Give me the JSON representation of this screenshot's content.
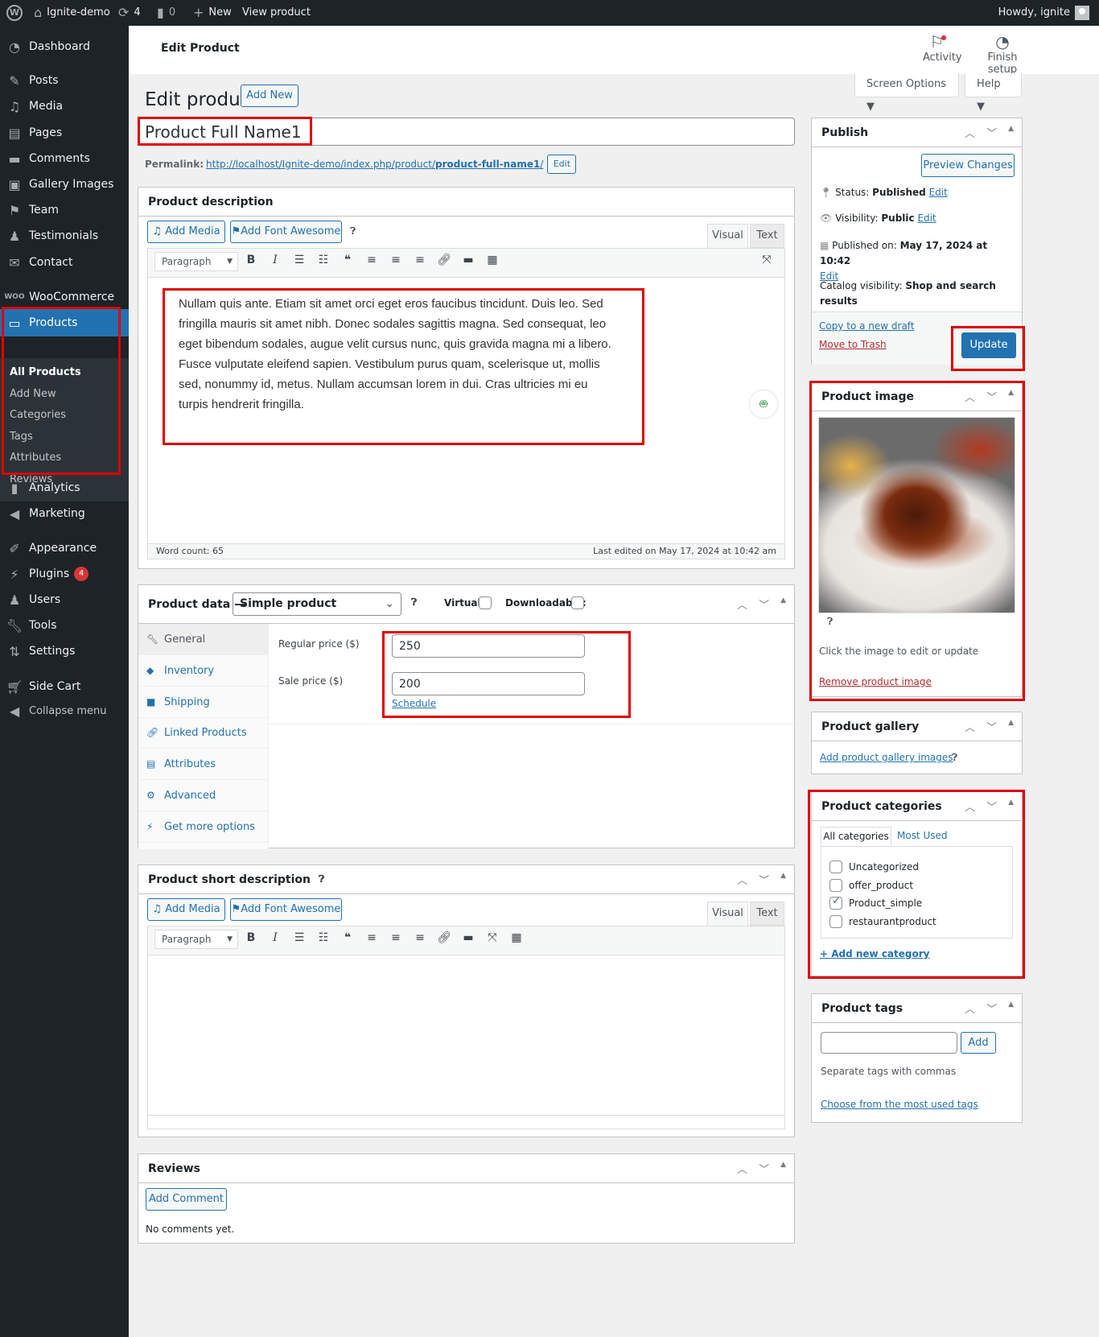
{
  "admin_bar": {
    "site_name": "Ignite-demo",
    "updates_count": "4",
    "comments_count": "0",
    "new_label": "New",
    "view_label": "View product",
    "greeting": "Howdy, ignite"
  },
  "sidebar": {
    "items": [
      {
        "label": "Dashboard",
        "icon": "dashboard-icon"
      },
      {
        "label": "Posts",
        "icon": "pin-icon"
      },
      {
        "label": "Media",
        "icon": "media-icon"
      },
      {
        "label": "Pages",
        "icon": "pages-icon"
      },
      {
        "label": "Comments",
        "icon": "comment-icon"
      },
      {
        "label": "Gallery Images",
        "icon": "gallery-icon"
      },
      {
        "label": "Team",
        "icon": "team-icon"
      },
      {
        "label": "Testimonials",
        "icon": "person-icon"
      },
      {
        "label": "Contact",
        "icon": "mail-icon"
      },
      {
        "label": "WooCommerce",
        "icon": "woo-icon"
      },
      {
        "label": "Products",
        "icon": "archive-icon"
      },
      {
        "label": "Analytics",
        "icon": "chart-icon"
      },
      {
        "label": "Marketing",
        "icon": "megaphone-icon"
      },
      {
        "label": "Appearance",
        "icon": "brush-icon"
      },
      {
        "label": "Plugins",
        "icon": "plugin-icon",
        "badge": "4"
      },
      {
        "label": "Users",
        "icon": "users-icon"
      },
      {
        "label": "Tools",
        "icon": "wrench-icon"
      },
      {
        "label": "Settings",
        "icon": "settings-icon"
      },
      {
        "label": "Side Cart",
        "icon": "cart-icon"
      },
      {
        "label": "Collapse menu",
        "icon": "collapse-icon"
      }
    ],
    "products_submenu": [
      "All Products",
      "Add New",
      "Categories",
      "Tags",
      "Attributes",
      "Reviews"
    ]
  },
  "header": {
    "title": "Edit Product",
    "activity_label": "Activity",
    "finish_setup_label": "Finish setup",
    "screen_options_label": "Screen Options ▼",
    "help_label": "Help ▼"
  },
  "page": {
    "heading": "Edit product",
    "add_new_label": "Add New",
    "product_title": "Product Full Name1",
    "permalink_label": "Permalink:",
    "permalink_base": "http://localhost/Ignite-demo/index.php/product/",
    "permalink_slug": "product-full-name1",
    "permalink_trailing": "/",
    "permalink_edit": "Edit"
  },
  "description": {
    "title": "Product description",
    "add_media": "Add Media",
    "add_font_awesome": "Add Font Awesome",
    "tab_visual": "Visual",
    "tab_text": "Text",
    "format": "Paragraph",
    "content": "Nullam quis ante. Etiam sit amet orci eget eros faucibus tincidunt. Duis leo. Sed fringilla mauris sit amet nibh. Donec sodales sagittis magna. Sed consequat, leo eget bibendum sodales, augue velit cursus nunc, quis gravida magna mi a libero. Fusce vulputate eleifend sapien. Vestibulum purus quam, scelerisque ut, mollis sed, nonummy id, metus. Nullam accumsan lorem in dui. Cras ultricies mi eu turpis hendrerit fringilla.",
    "word_count": "Word count: 65",
    "last_edited": "Last edited on May 17, 2024 at 10:42 am"
  },
  "product_data": {
    "title": "Product data —",
    "type": "Simple product",
    "virtual_label": "Virtual:",
    "downloadable_label": "Downloadable:",
    "virtual_checked": false,
    "downloadable_checked": false,
    "tabs": [
      "General",
      "Inventory",
      "Shipping",
      "Linked Products",
      "Attributes",
      "Advanced",
      "Get more options"
    ],
    "regular_price_label": "Regular price ($)",
    "regular_price": "250",
    "sale_price_label": "Sale price ($)",
    "sale_price": "200",
    "schedule_label": "Schedule"
  },
  "short_description": {
    "title": "Product short description",
    "add_media": "Add Media",
    "add_font_awesome": "Add Font Awesome",
    "tab_visual": "Visual",
    "tab_text": "Text",
    "format": "Paragraph",
    "content": ""
  },
  "reviews": {
    "title": "Reviews",
    "add_comment": "Add Comment",
    "empty": "No comments yet."
  },
  "publish": {
    "title": "Publish",
    "preview": "Preview Changes",
    "status_label": "Status:",
    "status_value": "Published",
    "visibility_label": "Visibility:",
    "visibility_value": "Public",
    "published_label": "Published on:",
    "published_value": "May 17, 2024 at 10:42",
    "catalog_label": "Catalog visibility:",
    "catalog_value": "Shop and search results",
    "edit": "Edit",
    "copy_draft": "Copy to a new draft",
    "trash": "Move to Trash",
    "update": "Update"
  },
  "product_image": {
    "title": "Product image",
    "hint": "Click the image to edit or update",
    "remove": "Remove product image"
  },
  "product_gallery": {
    "title": "Product gallery",
    "add": "Add product gallery images"
  },
  "product_categories": {
    "title": "Product categories",
    "tab_all": "All categories",
    "tab_most_used": "Most Used",
    "items": [
      {
        "label": "Uncategorized",
        "checked": false
      },
      {
        "label": "offer_product",
        "checked": false
      },
      {
        "label": "Product_simple",
        "checked": true
      },
      {
        "label": "restaurantproduct",
        "checked": false
      }
    ],
    "add_new": "+ Add new category"
  },
  "product_tags": {
    "title": "Product tags",
    "input_value": "",
    "add": "Add",
    "hint": "Separate tags with commas",
    "choose": "Choose from the most used tags"
  }
}
